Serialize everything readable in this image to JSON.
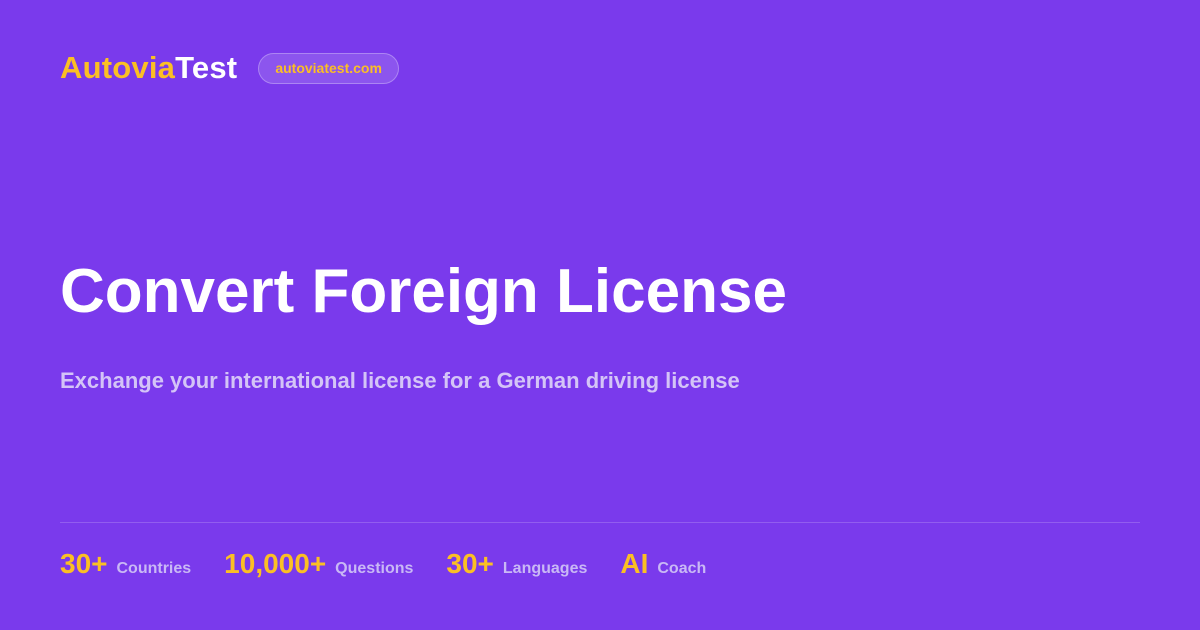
{
  "brand": {
    "part1": "Autovia",
    "part2": "Test",
    "domain_pill": "autoviatest.com"
  },
  "hero": {
    "title": "Convert Foreign License",
    "subtitle": "Exchange your international license for a German driving license"
  },
  "stats": [
    {
      "value": "30+",
      "label": "Countries"
    },
    {
      "value": "10,000+",
      "label": "Questions"
    },
    {
      "value": "30+",
      "label": "Languages"
    },
    {
      "value": "AI",
      "label": "Coach"
    }
  ],
  "colors": {
    "background": "#7a3aec",
    "accent": "#fbbf24",
    "text": "#ffffff",
    "muted": "#d4c4f7"
  }
}
